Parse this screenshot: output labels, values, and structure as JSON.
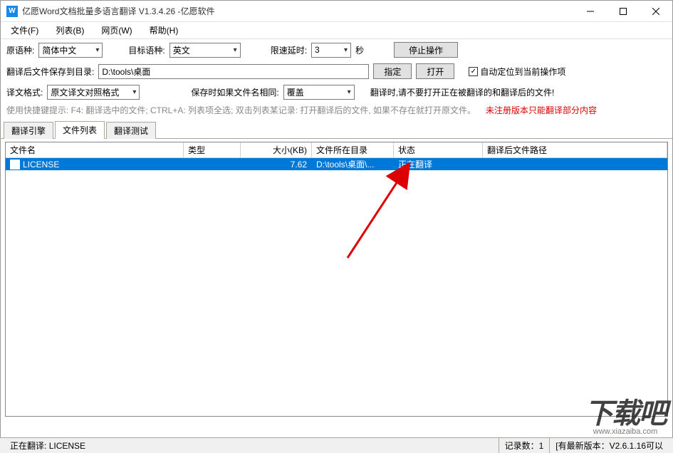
{
  "window": {
    "title": "亿愿Word文档批量多语言翻译 V1.3.4.26 -亿愿软件"
  },
  "menu": {
    "file": "文件(F)",
    "list": "列表(B)",
    "web": "网页(W)",
    "help": "帮助(H)"
  },
  "row1": {
    "src_lang_label": "原语种:",
    "src_lang_value": "简体中文",
    "tgt_lang_label": "目标语种:",
    "tgt_lang_value": "英文",
    "rate_label": "限速延时:",
    "rate_value": "3",
    "rate_unit": "秒",
    "stop_btn": "停止操作"
  },
  "row2": {
    "save_dir_label": "翻译后文件保存到目录:",
    "save_dir_value": "D:\\tools\\桌面",
    "locate_btn": "指定",
    "open_btn": "打开",
    "autoloc_label": "自动定位到当前操作项"
  },
  "row3": {
    "format_label": "译文格式:",
    "format_value": "原文译文对照格式",
    "dup_label": "保存时如果文件名相同:",
    "dup_value": "覆盖",
    "warn_text": "翻译时,请不要打开正在被翻译的和翻译后的文件!"
  },
  "row4": {
    "hint": "使用快捷键提示: F4: 翻译选中的文件; CTRL+A: 列表项全选; 双击列表某记录: 打开翻译后的文件, 如果不存在就打开原文件。",
    "unreg": "未注册版本只能翻译部分内容"
  },
  "tabs": {
    "t1": "翻译引擎",
    "t2": "文件列表",
    "t3": "翻译测试"
  },
  "columns": {
    "name": "文件名",
    "type": "类型",
    "size": "大小(KB)",
    "dir": "文件所在目录",
    "status": "状态",
    "result": "翻译后文件路径"
  },
  "rows": [
    {
      "name": "LICENSE",
      "type": "",
      "size": "7.62",
      "dir": "D:\\tools\\桌面\\...",
      "status": "正在翻译",
      "result": ""
    }
  ],
  "statusbar": {
    "translating_label": "正在翻译:",
    "translating_file": "LICENSE",
    "count_label": "记录数：",
    "count_value": "1",
    "version_hint": "[有最新版本：V2.6.1.16可以"
  },
  "watermark": {
    "big": "下载吧",
    "small": "www.xiazaiba.com"
  }
}
